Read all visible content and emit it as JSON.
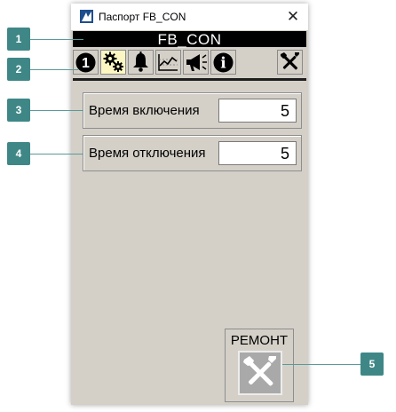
{
  "window": {
    "title": "Паспорт FB_CON",
    "close_glyph": "✕"
  },
  "name_bar": {
    "text": "FB_CON"
  },
  "toolbar": {
    "items": [
      {
        "name": "info-number-icon",
        "glyph": "1",
        "active": false
      },
      {
        "name": "settings-gears-icon",
        "active": true
      },
      {
        "name": "bell-icon",
        "active": false
      },
      {
        "name": "trend-chart-icon",
        "active": false
      },
      {
        "name": "megaphone-icon",
        "active": false
      },
      {
        "name": "info-icon",
        "glyph": "i",
        "active": false
      },
      {
        "name": "tools-icon",
        "active": false
      }
    ]
  },
  "params": [
    {
      "label": "Время включения",
      "value": "5"
    },
    {
      "label": "Время отключения",
      "value": "5"
    }
  ],
  "repair": {
    "label": "РЕМОНТ",
    "icon": "tools-icon"
  },
  "callouts": [
    "1",
    "2",
    "3",
    "4",
    "5"
  ],
  "colors": {
    "window_bg": "#d4d0c8",
    "active_tab": "#fbf6c2",
    "callout": "#3f8787",
    "name_bar_bg": "#000000"
  }
}
